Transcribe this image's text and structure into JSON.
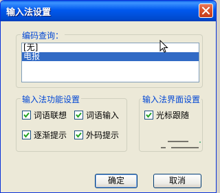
{
  "window": {
    "title": "输入法设置"
  },
  "code_query": {
    "legend": "编码查询：",
    "items": [
      "[无]",
      "电报"
    ],
    "selected_index": 1
  },
  "features": {
    "legend": "输入法功能设置",
    "options": [
      {
        "label": "词语联想",
        "checked": true
      },
      {
        "label": "词语输入",
        "checked": true
      },
      {
        "label": "逐渐提示",
        "checked": true
      },
      {
        "label": "外码提示",
        "checked": true
      }
    ]
  },
  "interface": {
    "legend": "输入法界面设置",
    "options": [
      {
        "label": "光标跟随",
        "checked": true
      }
    ]
  },
  "buttons": {
    "ok": "确定",
    "cancel": "取消"
  },
  "colors": {
    "title_bar": "#0054e3",
    "selection": "#316ac5",
    "legend_text": "#0046d5"
  }
}
